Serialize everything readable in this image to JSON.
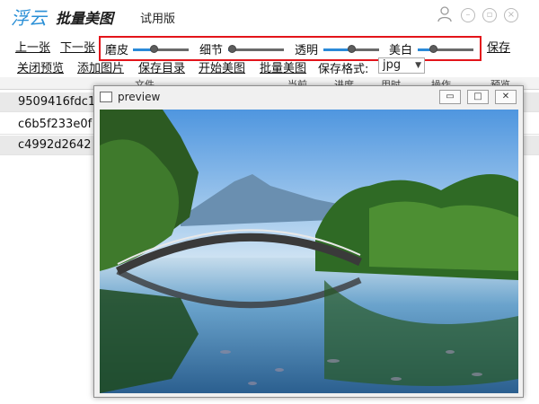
{
  "app": {
    "logo": "浮云",
    "name": "批量美图",
    "trial": "试用版"
  },
  "window_controls": {
    "user_icon": "user-icon",
    "minimize": "–",
    "restore": "▫",
    "close": "×"
  },
  "toolbar": {
    "prev": "上一张",
    "next": "下一张",
    "sliders": [
      {
        "label": "磨皮",
        "value": 0.35
      },
      {
        "label": "细节",
        "value": 0.0
      },
      {
        "label": "透明",
        "value": 0.5
      },
      {
        "label": "美白",
        "value": 0.25
      }
    ],
    "save": "保存",
    "close_preview": "关闭预览",
    "add_image": "添加图片",
    "save_dir": "保存目录",
    "start_beautify": "开始美图",
    "batch_beautify": "批量美图",
    "format_label": "保存格式:",
    "format_value": "jpg"
  },
  "list": {
    "columns": [
      "文件",
      "当前",
      "进度",
      "用时",
      "操作",
      "预览"
    ],
    "rows": [
      "9509416fdc1",
      "c6b5f233e0f",
      "c4992d2642"
    ]
  },
  "preview": {
    "title": "preview",
    "minimize": "▭",
    "maximize": "□",
    "close": "✕"
  },
  "colors": {
    "accent": "#2b8ad8",
    "highlight_border": "#e3141a",
    "logo": "#2a8fd6"
  }
}
